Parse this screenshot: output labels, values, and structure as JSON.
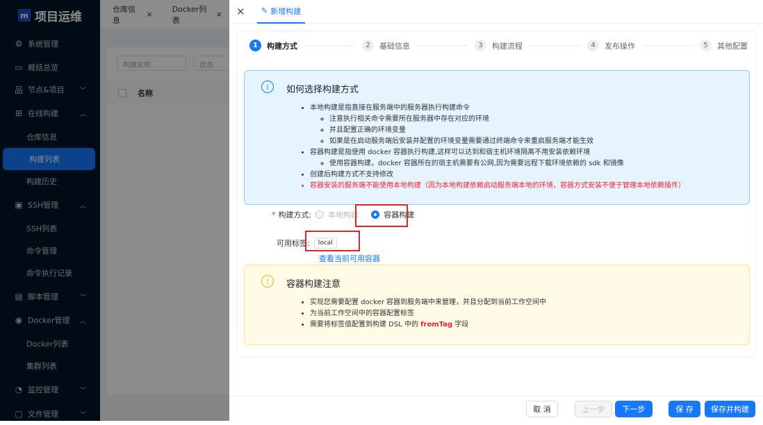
{
  "app": {
    "title": "项目运维",
    "logo_letter": "m"
  },
  "sidebar": {
    "items": [
      {
        "label": "系统管理",
        "icon": "gear-icon",
        "type": "top"
      },
      {
        "label": "概括总览",
        "icon": "laptop-icon",
        "type": "top"
      },
      {
        "label": "节点&项目",
        "icon": "apartment-icon",
        "type": "top",
        "chevron": "down"
      },
      {
        "label": "在线构建",
        "icon": "build-icon",
        "type": "top",
        "chevron": "up"
      },
      {
        "label": "仓库信息",
        "type": "sub"
      },
      {
        "label": "构建列表",
        "type": "sub",
        "selected": true
      },
      {
        "label": "构建历史",
        "type": "sub"
      },
      {
        "label": "SSH管理",
        "icon": "terminal-icon",
        "type": "top",
        "chevron": "up"
      },
      {
        "label": "SSH列表",
        "type": "sub"
      },
      {
        "label": "命令管理",
        "type": "sub"
      },
      {
        "label": "命令执行记录",
        "type": "sub"
      },
      {
        "label": "脚本管理",
        "icon": "script-icon",
        "type": "top",
        "chevron": "down"
      },
      {
        "label": "Docker管理",
        "icon": "docker-icon",
        "type": "top",
        "chevron": "up"
      },
      {
        "label": "Docker列表",
        "type": "sub"
      },
      {
        "label": "集群列表",
        "type": "sub"
      },
      {
        "label": "监控管理",
        "icon": "monitor-icon",
        "type": "top",
        "chevron": "down"
      },
      {
        "label": "文件管理",
        "icon": "file-icon",
        "type": "top",
        "chevron": "down"
      }
    ]
  },
  "background": {
    "tabs": [
      "仓库信息",
      "Docker列表"
    ],
    "filter_name_placeholder": "构建名称",
    "filter_status_placeholder": "状态",
    "column_name": "名称"
  },
  "drawer": {
    "tab_title": "新增构建",
    "steps": [
      {
        "n": "1",
        "label": "构建方式",
        "active": true
      },
      {
        "n": "2",
        "label": "基础信息"
      },
      {
        "n": "3",
        "label": "构建流程"
      },
      {
        "n": "4",
        "label": "发布操作"
      },
      {
        "n": "5",
        "label": "其他配置"
      }
    ],
    "info": {
      "title": "如何选择构建方式",
      "b1": "本地构建是指直接在服务端中的服务器执行构建命令",
      "b1s": [
        "注意执行相关命令需要所在服务器中存在对应的环境",
        "并且配置正确的环境变量",
        "如果是在启动服务端后安装并配置的环境变量需要通过终端命令来重启服务端才能生效"
      ],
      "b2": "容器构建是指使用 docker 容器执行构建,这样可以达到和宿主机环境隔离不用安装依赖环境",
      "b2s": [
        "使用容器构建，docker 容器所在的宿主机需要有公网,因为需要远程下载环境依赖的 sdk 和镜像"
      ],
      "b3": "创建后构建方式不支持修改",
      "b4": "容器安装的服务端不能使用本地构建（因为本地构建依赖启动服务端本地的环境，容器方式安装不便于管理本地依赖插件）"
    },
    "form": {
      "build_mode_label": "构建方式:",
      "option_local": "本地构建",
      "option_container": "容器构建",
      "selected": "容器构建",
      "tags_label": "可用标签:",
      "tag": "local",
      "view_link": "查看当前可用容器"
    },
    "warn": {
      "title": "容器构建注意",
      "i1": "实现您需要配置 docker 容器到服务端中来管理，并且分配到当前工作空间中",
      "i2": "为当前工作空间中的容器配置标签",
      "i3a": "需要将标签值配置到构建 DSL 中的 ",
      "i3b": "fromTag",
      "i3c": " 字段"
    },
    "buttons": {
      "cancel": "取 消",
      "prev": "上一步",
      "next": "下一步",
      "save": "保 存",
      "save_build": "保存并构建"
    }
  },
  "colors": {
    "primary": "#1677ff",
    "sidebar": "#001529",
    "danger": "#f5222d"
  }
}
